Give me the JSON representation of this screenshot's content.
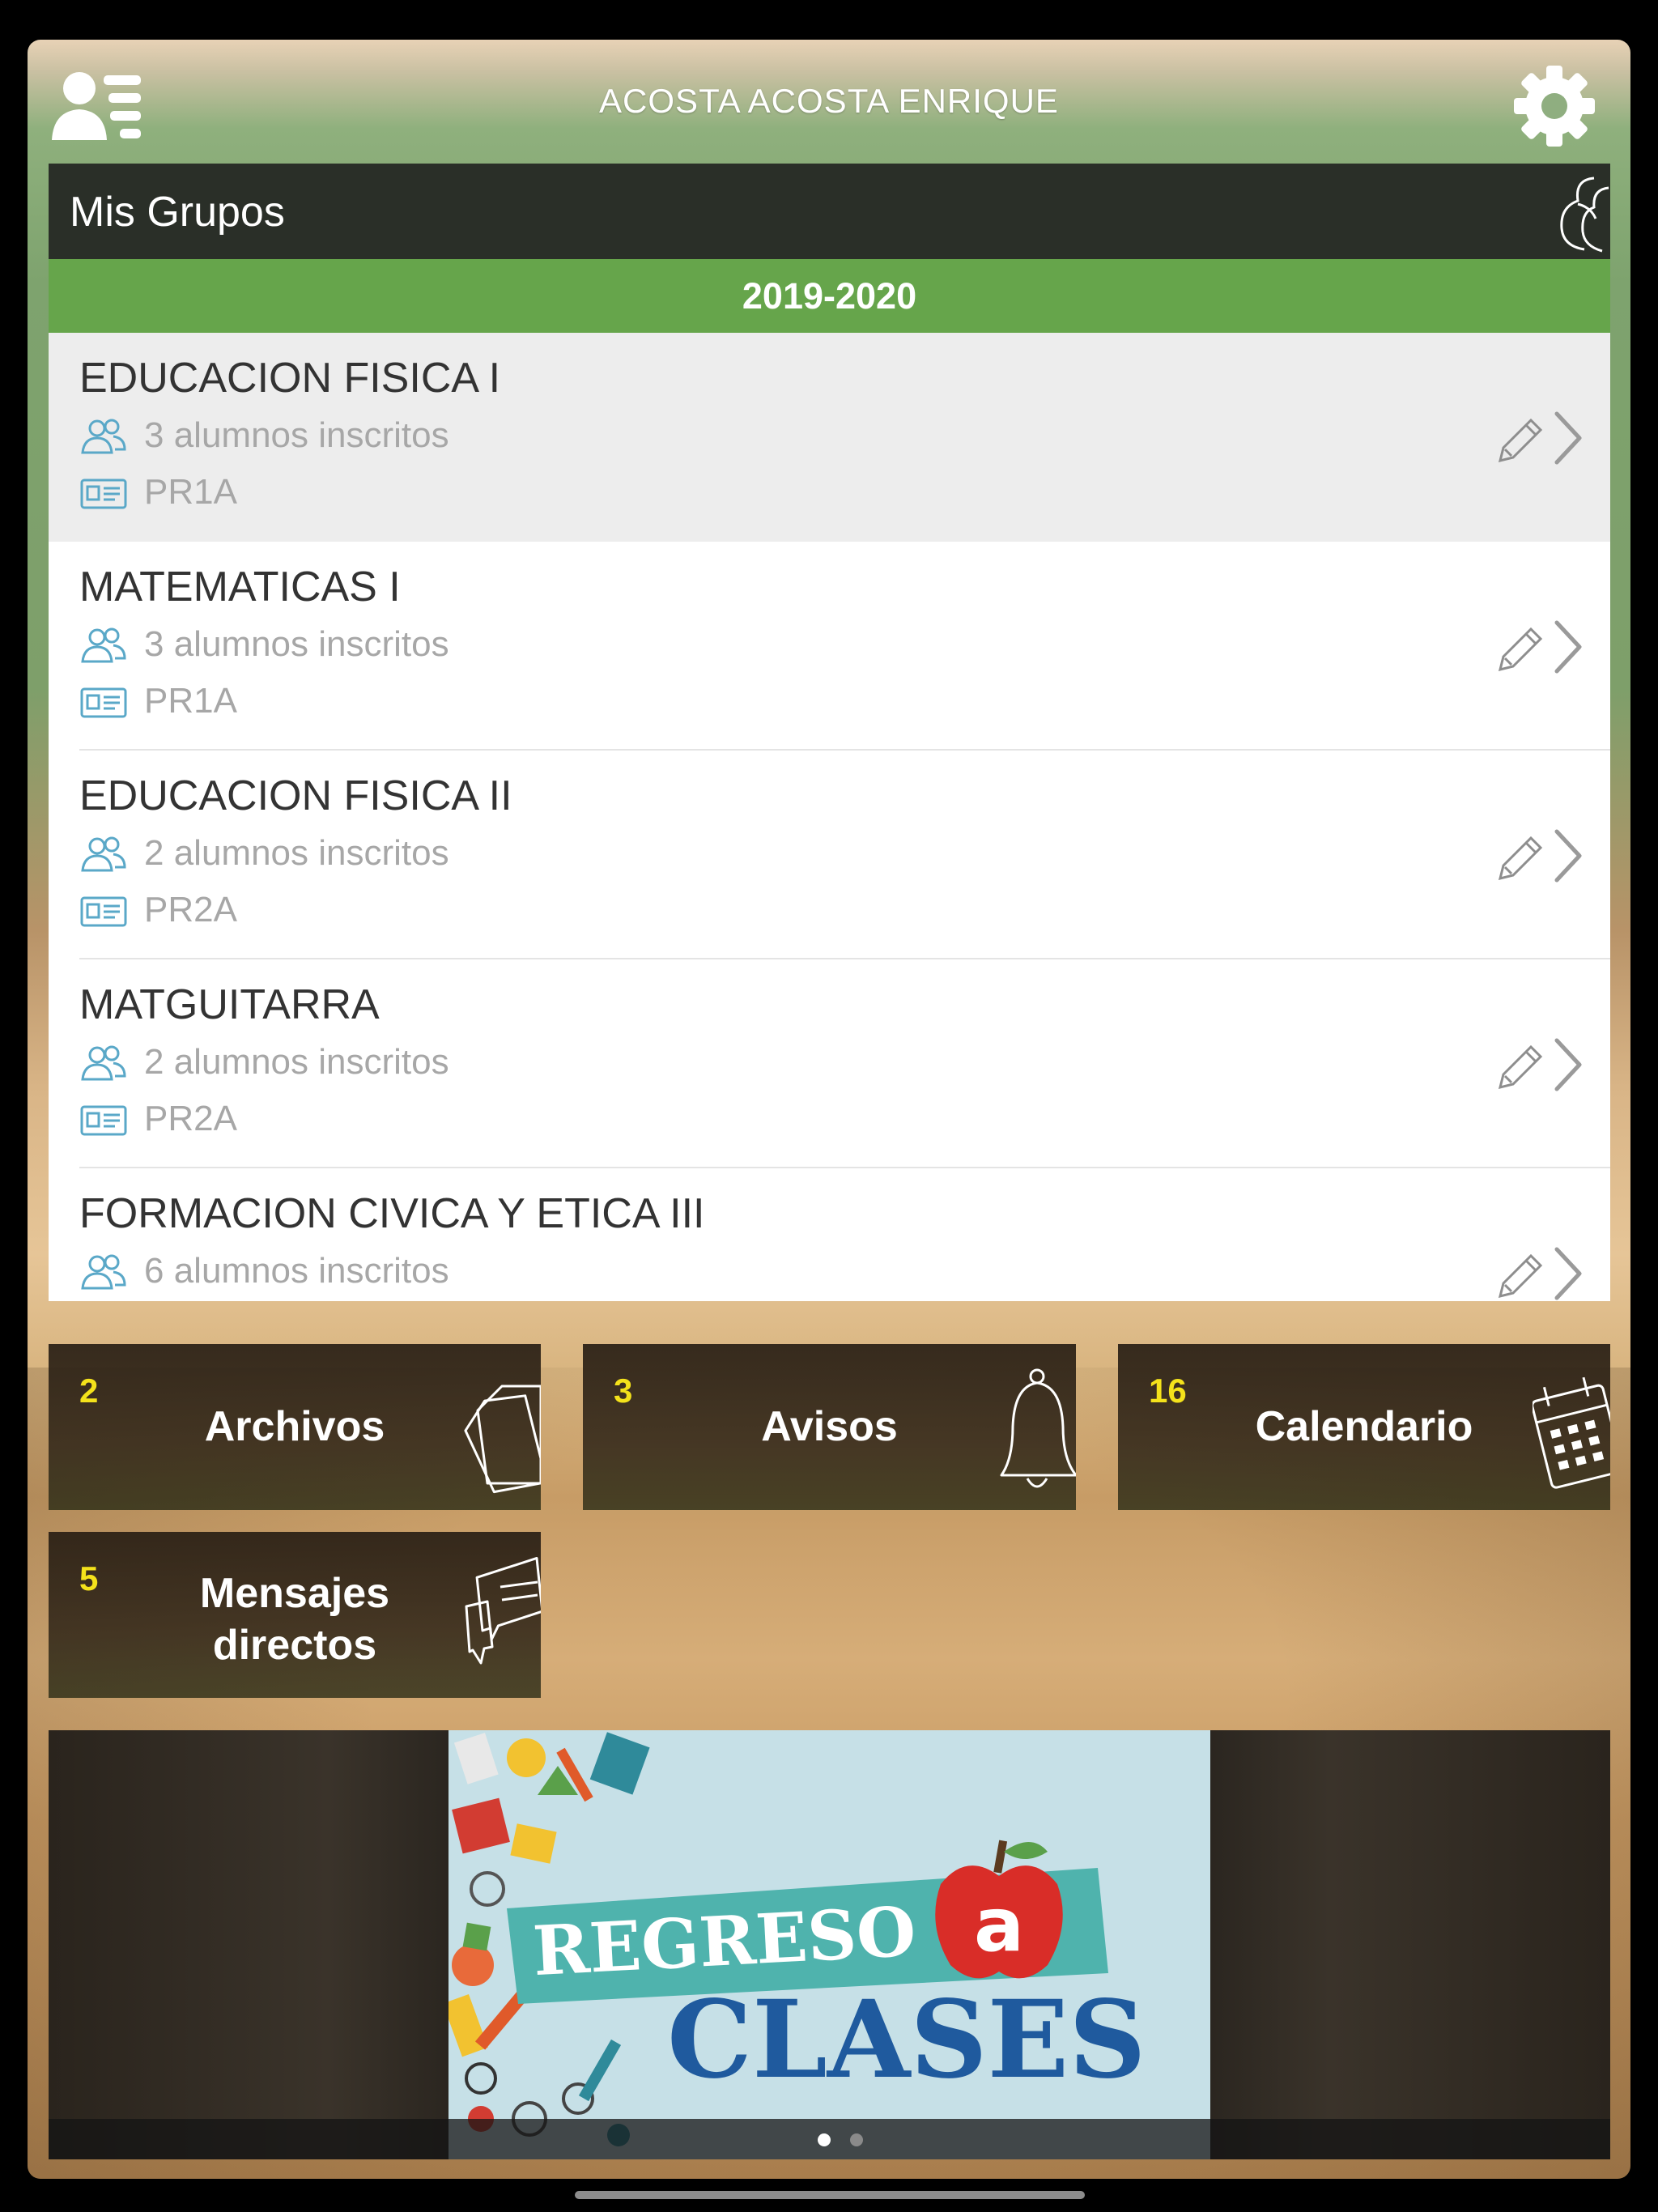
{
  "header": {
    "title": "ACOSTA ACOSTA ENRIQUE",
    "profile_icon": "user-list-icon",
    "settings_icon": "gear-icon"
  },
  "groups": {
    "title": "Mis Grupos",
    "year": "2019-2020",
    "items": [
      {
        "name": "EDUCACION FISICA I",
        "students": "3 alumnos inscritos",
        "code": "PR1A"
      },
      {
        "name": "MATEMATICAS I",
        "students": "3 alumnos inscritos",
        "code": "PR1A"
      },
      {
        "name": "EDUCACION FISICA II",
        "students": "2 alumnos inscritos",
        "code": "PR2A"
      },
      {
        "name": "MATGUITARRA",
        "students": "2 alumnos inscritos",
        "code": "PR2A"
      },
      {
        "name": "FORMACION CIVICA Y ETICA III",
        "students": "6 alumnos inscritos",
        "code": ""
      }
    ]
  },
  "tiles": {
    "archivos": {
      "count": "2",
      "label": "Archivos",
      "icon": "files-icon"
    },
    "avisos": {
      "count": "3",
      "label": "Avisos",
      "icon": "bell-icon"
    },
    "calendario": {
      "count": "16",
      "label": "Calendario",
      "icon": "calendar-icon"
    },
    "mensajes": {
      "count": "5",
      "label_line1": "Mensajes",
      "label_line2": "directos",
      "icon": "chat-icon"
    }
  },
  "banner": {
    "line1": "REGRESO",
    "apple_letter": "a",
    "line2": "CLASES",
    "pages": 2,
    "current_page": 1
  },
  "colors": {
    "year_bar": "#66a54b",
    "groups_header": "#2a2f28",
    "tile_count": "#f4e21b",
    "meta_icon": "#5aa8c8"
  }
}
